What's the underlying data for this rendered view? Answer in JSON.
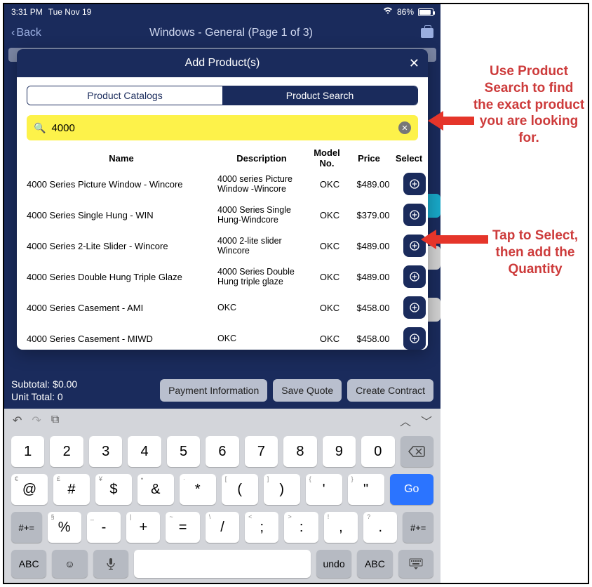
{
  "statusbar": {
    "time": "3:31 PM",
    "date": "Tue Nov 19",
    "battery": "86%"
  },
  "nav": {
    "back": "Back",
    "title": "Windows - General (Page 1 of 3)"
  },
  "modal": {
    "title": "Add Product(s)",
    "tab_catalogs": "Product Catalogs",
    "tab_search": "Product Search",
    "search_value": "4000",
    "columns": {
      "name": "Name",
      "desc": "Description",
      "model": "Model No.",
      "price": "Price",
      "select": "Select"
    },
    "rows": [
      {
        "name": "4000 Series Picture Window - Wincore",
        "desc": "4000 series Picture Window -Wincore",
        "model": "OKC",
        "price": "$489.00"
      },
      {
        "name": "4000 Series Single Hung - WIN",
        "desc": "4000 Series Single Hung-Windcore",
        "model": "OKC",
        "price": "$379.00"
      },
      {
        "name": "4000 Series 2-Lite Slider - Wincore",
        "desc": "4000 2-lite slider Wincore",
        "model": "OKC",
        "price": "$489.00"
      },
      {
        "name": "4000 Series Double Hung Triple Glaze",
        "desc": "4000 Series Double Hung triple glaze",
        "model": "OKC",
        "price": "$489.00"
      },
      {
        "name": "4000 Series Casement - AMI",
        "desc": "OKC",
        "model": "OKC",
        "price": "$458.00"
      },
      {
        "name": "4000 Series Casement - MIWD",
        "desc": "OKC",
        "model": "OKC",
        "price": "$458.00"
      }
    ]
  },
  "footer": {
    "subtotal": "Subtotal: $0.00",
    "unit_total": "Unit Total: 0",
    "payment": "Payment Information",
    "save": "Save Quote",
    "contract": "Create Contract"
  },
  "keyboard": {
    "row1": [
      "1",
      "2",
      "3",
      "4",
      "5",
      "6",
      "7",
      "8",
      "9",
      "0"
    ],
    "row2": [
      {
        "main": "@",
        "hint": "€"
      },
      {
        "main": "#",
        "hint": "£"
      },
      {
        "main": "$",
        "hint": "¥"
      },
      {
        "main": "&",
        "hint": "•"
      },
      {
        "main": "*",
        "hint": "·"
      },
      {
        "main": "(",
        "hint": "["
      },
      {
        "main": ")",
        "hint": "]"
      },
      {
        "main": "'",
        "hint": "{"
      },
      {
        "main": "\"",
        "hint": "}"
      }
    ],
    "row3_side": "#+=",
    "row3": [
      {
        "main": "%",
        "hint": "§"
      },
      {
        "main": "-",
        "hint": "_"
      },
      {
        "main": "+",
        "hint": "|"
      },
      {
        "main": "=",
        "hint": "~"
      },
      {
        "main": "/",
        "hint": "\\"
      },
      {
        "main": ";",
        "hint": "<"
      },
      {
        "main": ":",
        "hint": ">"
      },
      {
        "main": ",",
        "hint": "!"
      },
      {
        "main": ".",
        "hint": "?"
      }
    ],
    "go": "Go",
    "abc": "ABC",
    "undo": "undo"
  },
  "annotations": {
    "a1": "Use Product Search to find the exact product you are looking for.",
    "a2": "Tap to Select, then add the Quantity"
  }
}
